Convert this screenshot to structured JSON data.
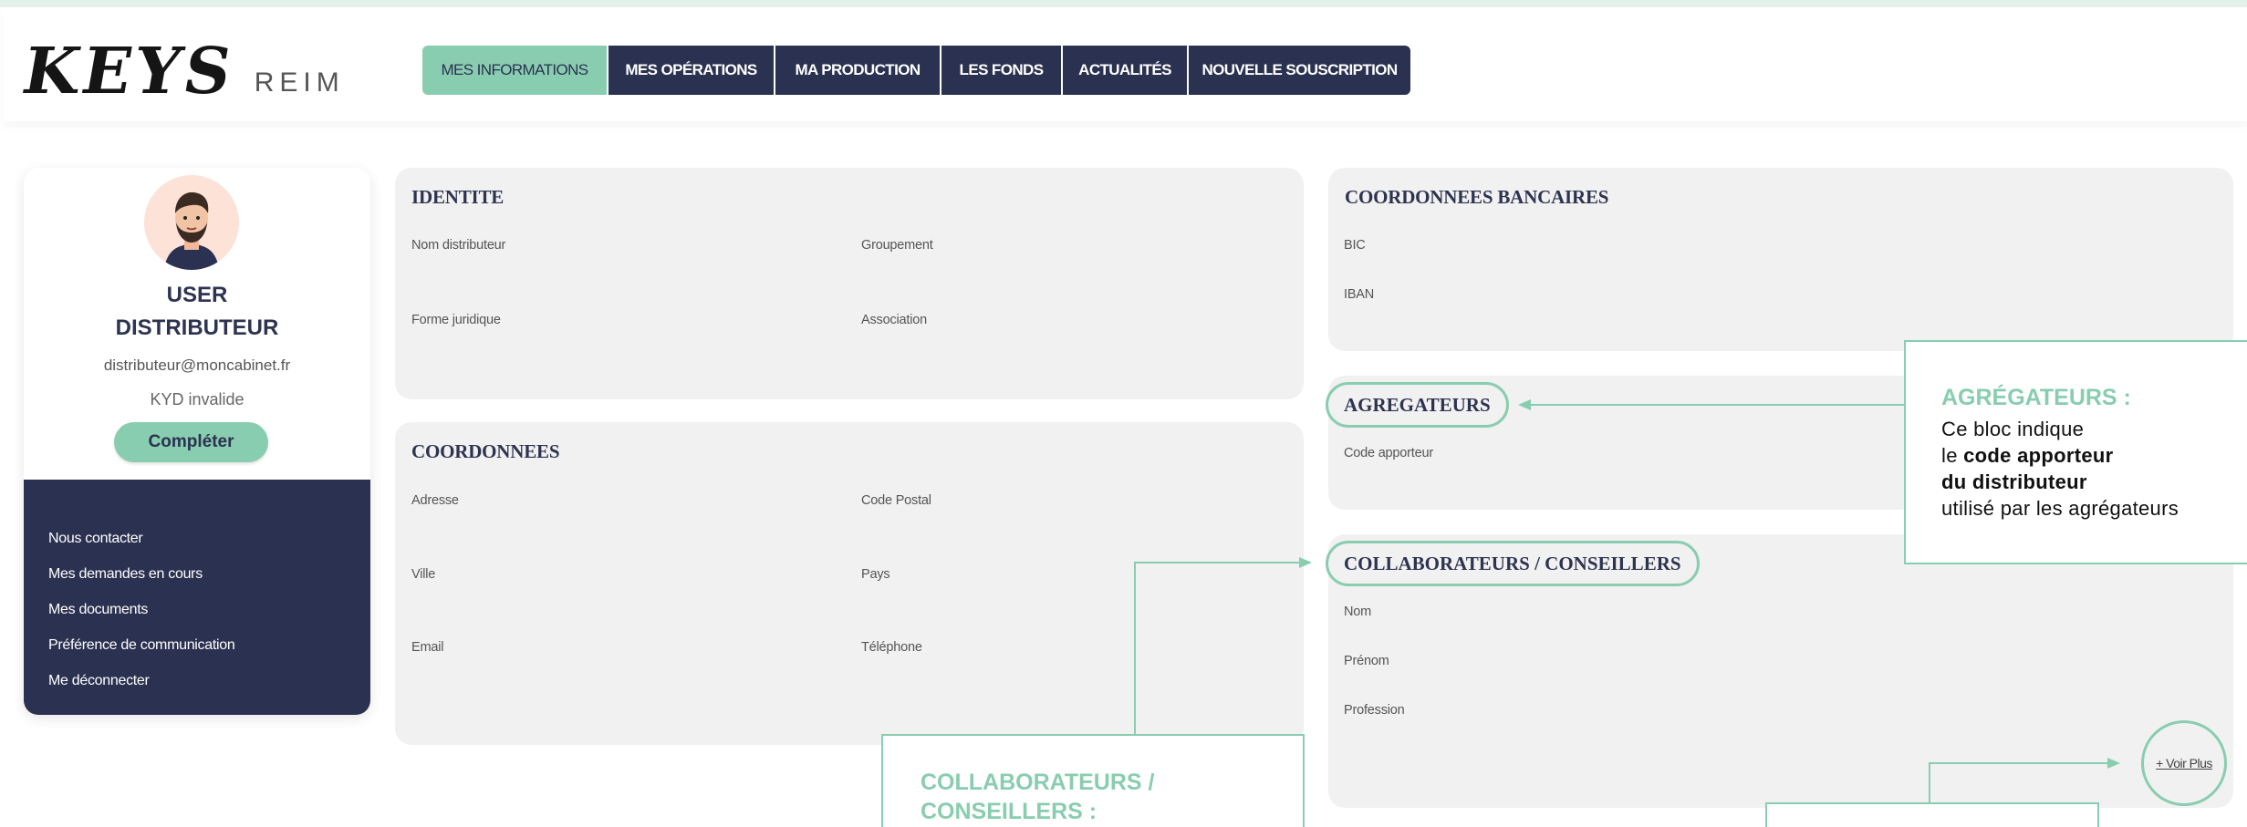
{
  "brand": {
    "logo_main": "KEYS",
    "logo_sub": "REIM"
  },
  "nav": {
    "items": [
      {
        "label": "MES INFORMATIONS",
        "active": true
      },
      {
        "label": "MES OPÉRATIONS",
        "active": false
      },
      {
        "label": "MA PRODUCTION",
        "active": false
      },
      {
        "label": "LES FONDS",
        "active": false
      },
      {
        "label": "ACTUALITÉS",
        "active": false
      },
      {
        "label": "NOUVELLE SOUSCRIPTION",
        "active": false
      }
    ]
  },
  "profile": {
    "name_line1": "USER",
    "name_line2": "DISTRIBUTEUR",
    "email": "distributeur@moncabinet.fr",
    "kyd_status": "KYD invalide",
    "complete_label": "Compléter",
    "menu": [
      "Nous contacter",
      "Mes demandes en cours",
      "Mes documents",
      "Préférence de communication",
      "Me déconnecter"
    ]
  },
  "identite": {
    "title": "IDENTITE",
    "fields": {
      "nom_distributeur": "Nom distributeur",
      "groupement": "Groupement",
      "forme_juridique": "Forme juridique",
      "association": "Association"
    }
  },
  "coordonnees": {
    "title": "COORDONNEES",
    "fields": {
      "adresse": "Adresse",
      "code_postal": "Code Postal",
      "ville": "Ville",
      "pays": "Pays",
      "email": "Email",
      "telephone": "Téléphone"
    }
  },
  "bancaires": {
    "title": "COORDONNEES BANCAIRES",
    "fields": {
      "bic": "BIC",
      "iban": "IBAN"
    }
  },
  "agregateurs": {
    "title": "AGREGATEURS",
    "fields": {
      "code_apporteur": "Code apporteur"
    }
  },
  "collaborateurs": {
    "title": "COLLABORATEURS / CONSEILLERS",
    "fields": {
      "nom": "Nom",
      "prenom": "Prénom",
      "profession": "Profession"
    },
    "voir_plus": "+ Voir Plus"
  },
  "annotations": {
    "agregateurs": {
      "title": "AGRÉGATEURS :",
      "line1": "Ce bloc indique",
      "line2_prefix": "le ",
      "line2_bold": "code apporteur",
      "line3_bold": "du distributeur",
      "line4": "utilisé par les agrégateurs"
    },
    "collaborateurs": {
      "title_line1": "COLLABORATEURS /",
      "title_line2": "CONSEILLERS :"
    }
  },
  "colors": {
    "accent": "#89cdb0",
    "navy": "#2b3150",
    "panel": "#f1f1f1"
  }
}
